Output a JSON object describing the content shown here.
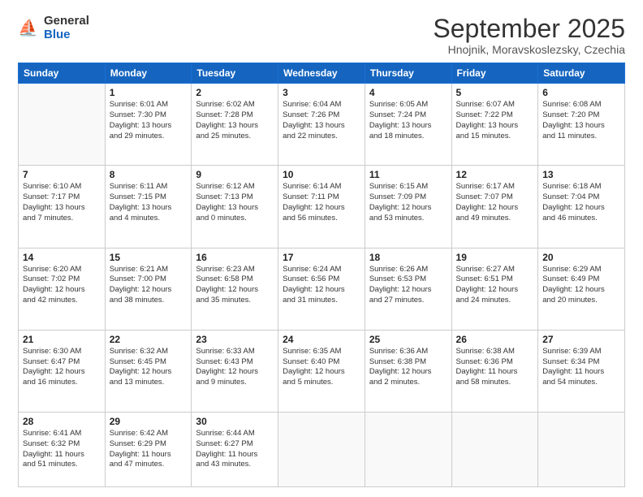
{
  "logo": {
    "general": "General",
    "blue": "Blue"
  },
  "header": {
    "month": "September 2025",
    "location": "Hnojnik, Moravskoslezsky, Czechia"
  },
  "weekdays": [
    "Sunday",
    "Monday",
    "Tuesday",
    "Wednesday",
    "Thursday",
    "Friday",
    "Saturday"
  ],
  "weeks": [
    [
      {
        "day": "",
        "info": ""
      },
      {
        "day": "1",
        "info": "Sunrise: 6:01 AM\nSunset: 7:30 PM\nDaylight: 13 hours\nand 29 minutes."
      },
      {
        "day": "2",
        "info": "Sunrise: 6:02 AM\nSunset: 7:28 PM\nDaylight: 13 hours\nand 25 minutes."
      },
      {
        "day": "3",
        "info": "Sunrise: 6:04 AM\nSunset: 7:26 PM\nDaylight: 13 hours\nand 22 minutes."
      },
      {
        "day": "4",
        "info": "Sunrise: 6:05 AM\nSunset: 7:24 PM\nDaylight: 13 hours\nand 18 minutes."
      },
      {
        "day": "5",
        "info": "Sunrise: 6:07 AM\nSunset: 7:22 PM\nDaylight: 13 hours\nand 15 minutes."
      },
      {
        "day": "6",
        "info": "Sunrise: 6:08 AM\nSunset: 7:20 PM\nDaylight: 13 hours\nand 11 minutes."
      }
    ],
    [
      {
        "day": "7",
        "info": "Sunrise: 6:10 AM\nSunset: 7:17 PM\nDaylight: 13 hours\nand 7 minutes."
      },
      {
        "day": "8",
        "info": "Sunrise: 6:11 AM\nSunset: 7:15 PM\nDaylight: 13 hours\nand 4 minutes."
      },
      {
        "day": "9",
        "info": "Sunrise: 6:12 AM\nSunset: 7:13 PM\nDaylight: 13 hours\nand 0 minutes."
      },
      {
        "day": "10",
        "info": "Sunrise: 6:14 AM\nSunset: 7:11 PM\nDaylight: 12 hours\nand 56 minutes."
      },
      {
        "day": "11",
        "info": "Sunrise: 6:15 AM\nSunset: 7:09 PM\nDaylight: 12 hours\nand 53 minutes."
      },
      {
        "day": "12",
        "info": "Sunrise: 6:17 AM\nSunset: 7:07 PM\nDaylight: 12 hours\nand 49 minutes."
      },
      {
        "day": "13",
        "info": "Sunrise: 6:18 AM\nSunset: 7:04 PM\nDaylight: 12 hours\nand 46 minutes."
      }
    ],
    [
      {
        "day": "14",
        "info": "Sunrise: 6:20 AM\nSunset: 7:02 PM\nDaylight: 12 hours\nand 42 minutes."
      },
      {
        "day": "15",
        "info": "Sunrise: 6:21 AM\nSunset: 7:00 PM\nDaylight: 12 hours\nand 38 minutes."
      },
      {
        "day": "16",
        "info": "Sunrise: 6:23 AM\nSunset: 6:58 PM\nDaylight: 12 hours\nand 35 minutes."
      },
      {
        "day": "17",
        "info": "Sunrise: 6:24 AM\nSunset: 6:56 PM\nDaylight: 12 hours\nand 31 minutes."
      },
      {
        "day": "18",
        "info": "Sunrise: 6:26 AM\nSunset: 6:53 PM\nDaylight: 12 hours\nand 27 minutes."
      },
      {
        "day": "19",
        "info": "Sunrise: 6:27 AM\nSunset: 6:51 PM\nDaylight: 12 hours\nand 24 minutes."
      },
      {
        "day": "20",
        "info": "Sunrise: 6:29 AM\nSunset: 6:49 PM\nDaylight: 12 hours\nand 20 minutes."
      }
    ],
    [
      {
        "day": "21",
        "info": "Sunrise: 6:30 AM\nSunset: 6:47 PM\nDaylight: 12 hours\nand 16 minutes."
      },
      {
        "day": "22",
        "info": "Sunrise: 6:32 AM\nSunset: 6:45 PM\nDaylight: 12 hours\nand 13 minutes."
      },
      {
        "day": "23",
        "info": "Sunrise: 6:33 AM\nSunset: 6:43 PM\nDaylight: 12 hours\nand 9 minutes."
      },
      {
        "day": "24",
        "info": "Sunrise: 6:35 AM\nSunset: 6:40 PM\nDaylight: 12 hours\nand 5 minutes."
      },
      {
        "day": "25",
        "info": "Sunrise: 6:36 AM\nSunset: 6:38 PM\nDaylight: 12 hours\nand 2 minutes."
      },
      {
        "day": "26",
        "info": "Sunrise: 6:38 AM\nSunset: 6:36 PM\nDaylight: 11 hours\nand 58 minutes."
      },
      {
        "day": "27",
        "info": "Sunrise: 6:39 AM\nSunset: 6:34 PM\nDaylight: 11 hours\nand 54 minutes."
      }
    ],
    [
      {
        "day": "28",
        "info": "Sunrise: 6:41 AM\nSunset: 6:32 PM\nDaylight: 11 hours\nand 51 minutes."
      },
      {
        "day": "29",
        "info": "Sunrise: 6:42 AM\nSunset: 6:29 PM\nDaylight: 11 hours\nand 47 minutes."
      },
      {
        "day": "30",
        "info": "Sunrise: 6:44 AM\nSunset: 6:27 PM\nDaylight: 11 hours\nand 43 minutes."
      },
      {
        "day": "",
        "info": ""
      },
      {
        "day": "",
        "info": ""
      },
      {
        "day": "",
        "info": ""
      },
      {
        "day": "",
        "info": ""
      }
    ]
  ]
}
